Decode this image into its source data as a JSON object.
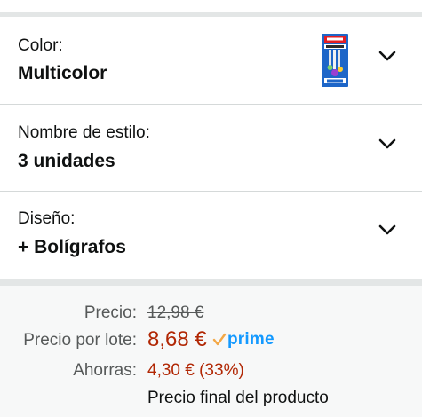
{
  "variations": [
    {
      "label": "Color:",
      "value": "Multicolor"
    },
    {
      "label": "Nombre de estilo:",
      "value": "3 unidades"
    },
    {
      "label": "Diseño:",
      "value": "+ Bolígrafos"
    }
  ],
  "price": {
    "list_label": "Precio:",
    "list_value": "12,98 €",
    "lot_label": "Precio por lote:",
    "lot_value": "8,68 €",
    "prime_label": "prime",
    "save_label": "Ahorras:",
    "save_value": "4,30 € (33%)",
    "final_note": "Precio final del producto"
  },
  "colors": {
    "price_red": "#b12704",
    "prime_blue": "#1399ff",
    "muted": "#565959",
    "divider": "#e3e6e6"
  },
  "icons": {
    "chevron": "chevron-down-icon",
    "prime_check": "prime-check-icon",
    "thumbnail": "product-thumbnail"
  }
}
